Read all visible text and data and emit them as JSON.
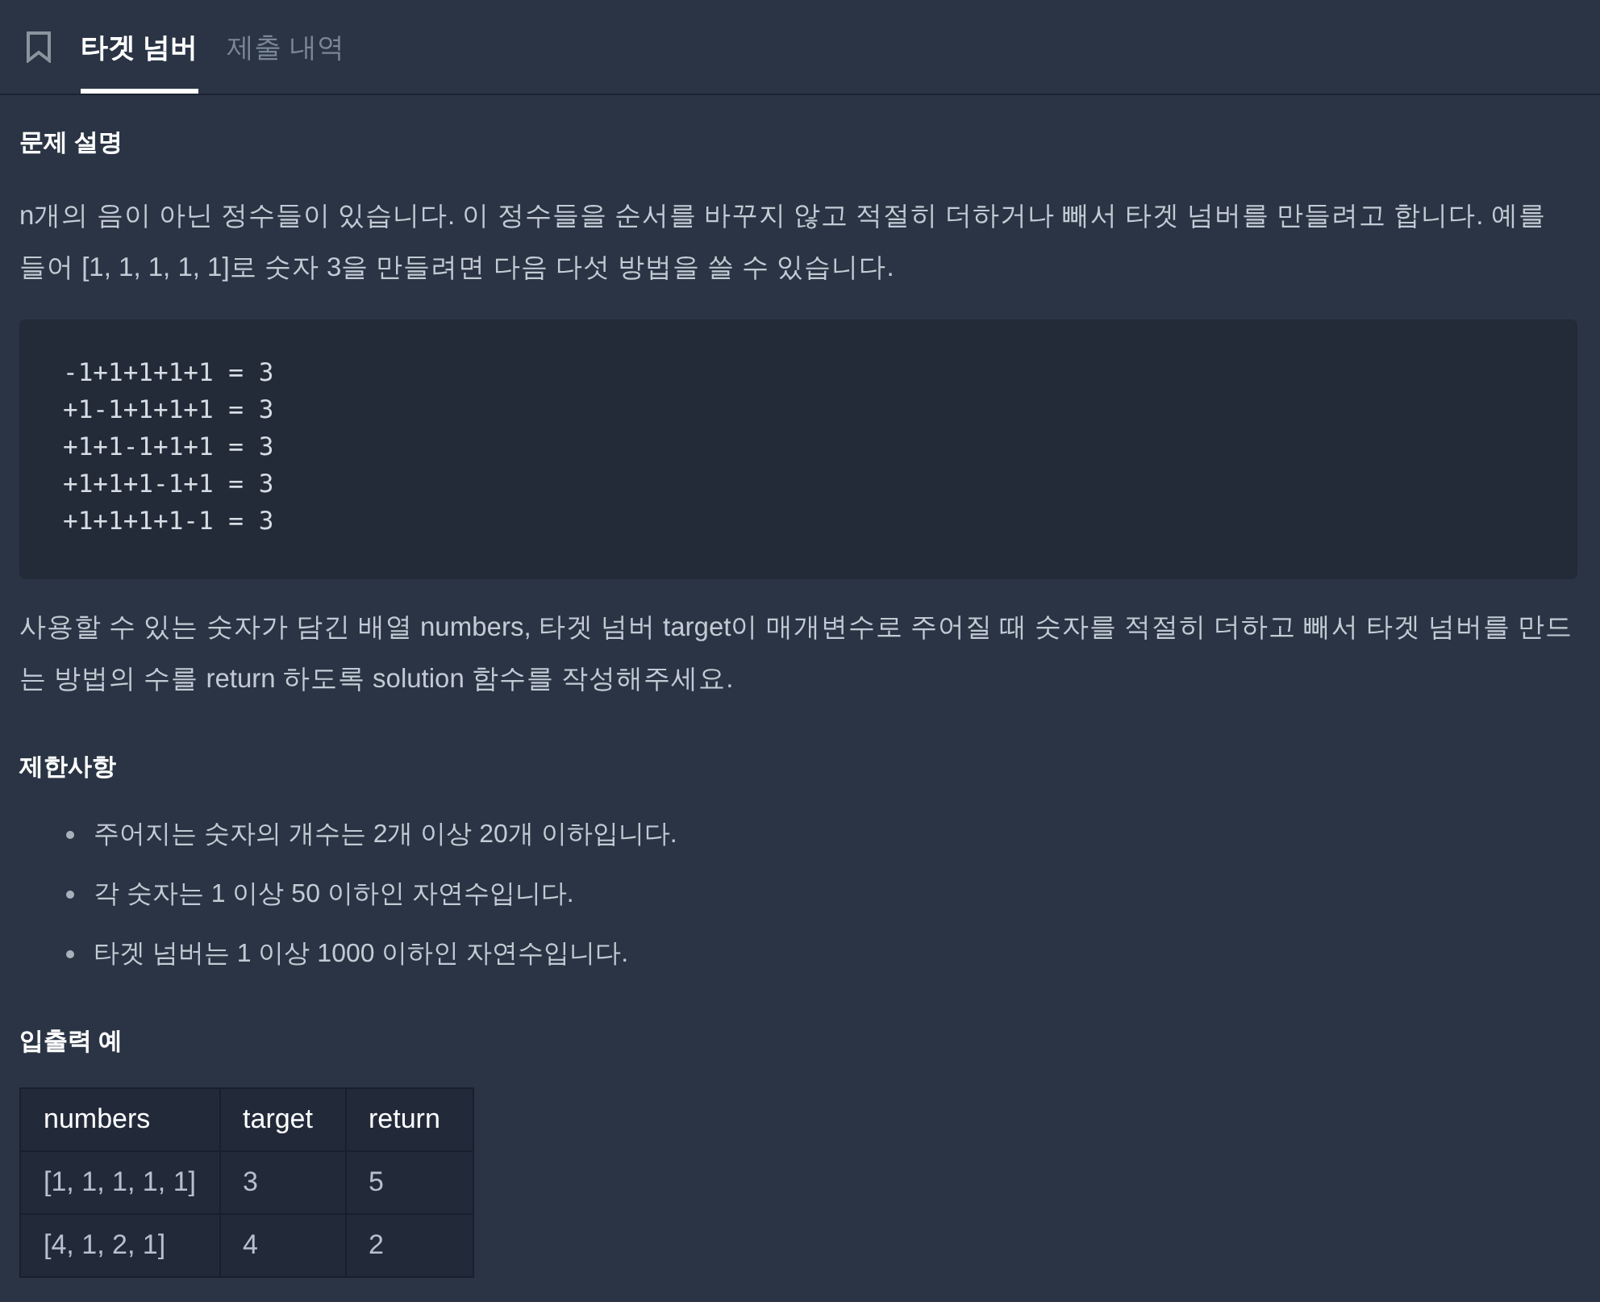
{
  "tabs": [
    {
      "label": "타겟 넘버",
      "selected": true
    },
    {
      "label": "제출 내역",
      "selected": false
    }
  ],
  "sections": [
    {
      "heading": "문제 설명",
      "blocks": [
        {
          "kind": "paragraph",
          "text": "n개의 음이 아닌 정수들이 있습니다. 이 정수들을 순서를 바꾸지 않고 적절히 더하거나 빼서 타겟 넘버를 만들려고 합니다. 예를 들어 [1, 1, 1, 1, 1]로 숫자 3을 만들려면 다음 다섯 방법을 쓸 수 있습니다."
        },
        {
          "kind": "code",
          "lines": [
            "-1+1+1+1+1 = 3",
            "+1-1+1+1+1 = 3",
            "+1+1-1+1+1 = 3",
            "+1+1+1-1+1 = 3",
            "+1+1+1+1-1 = 3"
          ]
        },
        {
          "kind": "paragraph",
          "text": "사용할 수 있는 숫자가 담긴 배열 numbers, 타겟 넘버 target이 매개변수로 주어질 때 숫자를 적절히 더하고 빼서 타겟 넘버를 만드는 방법의 수를 return 하도록 solution 함수를 작성해주세요."
        }
      ]
    },
    {
      "heading": "제한사항",
      "blocks": [
        {
          "kind": "list",
          "items": [
            "주어지는 숫자의 개수는 2개 이상 20개 이하입니다.",
            "각 숫자는 1 이상 50 이하인 자연수입니다.",
            "타겟 넘버는 1 이상 1000 이하인 자연수입니다."
          ]
        }
      ]
    },
    {
      "heading": "입출력 예",
      "blocks": [
        {
          "kind": "table",
          "columns": [
            "numbers",
            "target",
            "return"
          ],
          "rows": [
            [
              "[1, 1, 1, 1, 1]",
              "3",
              "5"
            ],
            [
              "[4, 1, 2, 1]",
              "4",
              "2"
            ]
          ]
        }
      ]
    }
  ]
}
